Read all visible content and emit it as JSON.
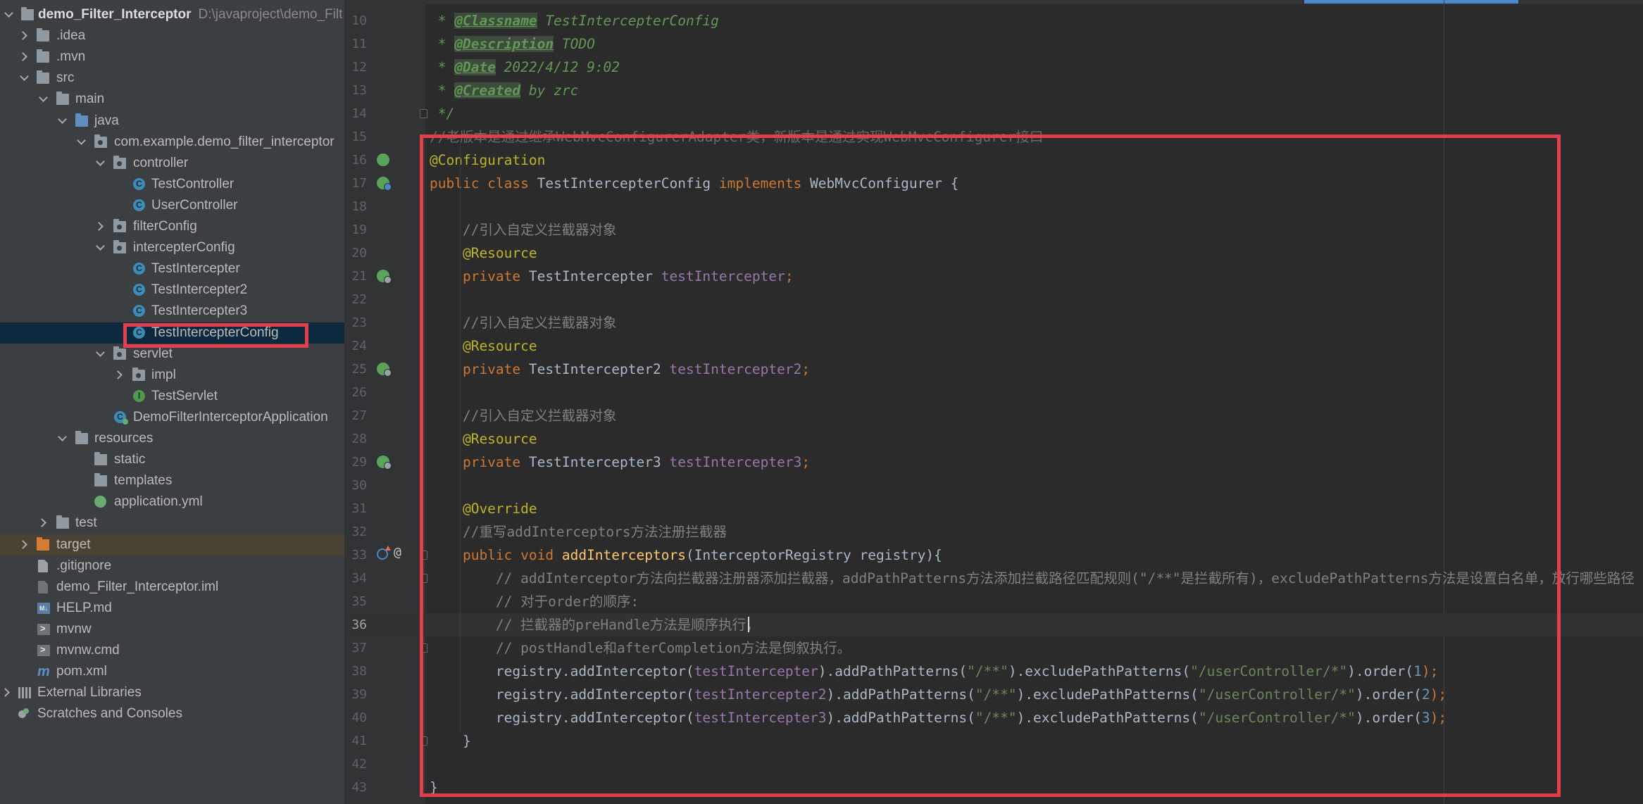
{
  "project_tree": {
    "root_name": "demo_Filter_Interceptor",
    "root_path": "D:\\javaproject\\demo_Filt",
    "items": [
      {
        "label": "demo_Filter_Interceptor"
      },
      {
        "label": ".idea"
      },
      {
        "label": ".mvn"
      },
      {
        "label": "src"
      },
      {
        "label": "main"
      },
      {
        "label": "java"
      },
      {
        "label": "com.example.demo_filter_interceptor"
      },
      {
        "label": "controller"
      },
      {
        "label": "TestController"
      },
      {
        "label": "UserController"
      },
      {
        "label": "filterConfig"
      },
      {
        "label": "intercepterConfig"
      },
      {
        "label": "TestIntercepter"
      },
      {
        "label": "TestIntercepter2"
      },
      {
        "label": "TestIntercepter3"
      },
      {
        "label": "TestIntercepterConfig"
      },
      {
        "label": "servlet"
      },
      {
        "label": "impl"
      },
      {
        "label": "TestServlet"
      },
      {
        "label": "DemoFilterInterceptorApplication"
      },
      {
        "label": "resources"
      },
      {
        "label": "static"
      },
      {
        "label": "templates"
      },
      {
        "label": "application.yml"
      },
      {
        "label": "test"
      },
      {
        "label": "target"
      },
      {
        "label": ".gitignore"
      },
      {
        "label": "demo_Filter_Interceptor.iml"
      },
      {
        "label": "HELP.md"
      },
      {
        "label": "mvnw"
      },
      {
        "label": "mvnw.cmd"
      },
      {
        "label": "pom.xml"
      },
      {
        "label": "External Libraries"
      },
      {
        "label": "Scratches and Consoles"
      }
    ]
  },
  "editor": {
    "file_name": "TestIntercepterConfig",
    "current_line": 36,
    "line_numbers": [
      "10",
      "11",
      "12",
      "13",
      "14",
      "15",
      "16",
      "17",
      "18",
      "19",
      "20",
      "21",
      "22",
      "23",
      "24",
      "25",
      "26",
      "27",
      "28",
      "29",
      "30",
      "31",
      "32",
      "33",
      "34",
      "35",
      "36",
      "37",
      "38",
      "39",
      "40",
      "41",
      "42",
      "43"
    ],
    "code": {
      "l10_star": " * ",
      "l10_tag": "@Classname",
      "l10_text": " TestIntercepterConfig",
      "l11_star": " * ",
      "l11_tag": "@Description",
      "l11_text": " TODO",
      "l12_star": " * ",
      "l12_tag": "@Date",
      "l12_text": " 2022/4/12 9:02",
      "l13_star": " * ",
      "l13_tag": "@Created",
      "l13_text": " by zrc",
      "l14": " */",
      "l15": "//老版本是通过继承WebMvcConfigurerAdapter类，新版本是通过实现WebMvcConfigurer接口",
      "l16": "@Configuration",
      "l17_kw1": "public class ",
      "l17_name": "TestIntercepterConfig ",
      "l17_kw2": "implements ",
      "l17_rest": "WebMvcConfigurer {",
      "l19": "    //引入自定义拦截器对象",
      "l20": "    @Resource",
      "l21_kw": "    private ",
      "l21_type": "TestIntercepter ",
      "l21_field": "testIntercepter",
      "l21_end": ";",
      "l23": "    //引入自定义拦截器对象",
      "l24": "    @Resource",
      "l25_kw": "    private ",
      "l25_type": "TestIntercepter2 ",
      "l25_field": "testIntercepter2",
      "l25_end": ";",
      "l27": "    //引入自定义拦截器对象",
      "l28": "    @Resource",
      "l29_kw": "    private ",
      "l29_type": "TestIntercepter3 ",
      "l29_field": "testIntercepter3",
      "l29_end": ";",
      "l31": "    @Override",
      "l32": "    //重写addInterceptors方法注册拦截器",
      "l33_kw": "    public void ",
      "l33_fn": "addInterceptors",
      "l33_rest": "(InterceptorRegistry registry){",
      "l34": "        // addInterceptor方法向拦截器注册器添加拦截器，addPathPatterns方法添加拦截路径匹配规则(\"/**\"是拦截所有)，excludePathPatterns方法是设置白名单，放行哪些路径",
      "l35": "        // 对于order的顺序:",
      "l36": "        // 拦截器的preHandle方法是顺序执行，",
      "l37": "        // postHandle和afterCompletion方法是倒叙执行。",
      "l38_a": "        registry.addInterceptor(",
      "l38_f": "testIntercepter",
      "l38_b": ").addPathPatterns(",
      "l38_s1": "\"/**\"",
      "l38_c": ").excludePathPatterns(",
      "l38_s2": "\"/userController/*\"",
      "l38_d": ").order(",
      "l38_n": "1",
      "l38_e": ");",
      "l39_a": "        registry.addInterceptor(",
      "l39_f": "testIntercepter2",
      "l39_b": ").addPathPatterns(",
      "l39_s1": "\"/**\"",
      "l39_c": ").excludePathPatterns(",
      "l39_s2": "\"/userController/*\"",
      "l39_d": ").order(",
      "l39_n": "2",
      "l39_e": ");",
      "l40_a": "        registry.addInterceptor(",
      "l40_f": "testIntercepter3",
      "l40_b": ").addPathPatterns(",
      "l40_s1": "\"/**\"",
      "l40_c": ").excludePathPatterns(",
      "l40_s2": "\"/userController/*\"",
      "l40_d": ").order(",
      "l40_n": "3",
      "l40_e": ");",
      "l41": "    }",
      "l43": "}"
    },
    "gutter_at": "@"
  },
  "colors": {
    "highlight_box": "#e43d4b",
    "keyword": "#cc7832",
    "annotation": "#bbb529",
    "field": "#9876aa",
    "string": "#6a8759"
  }
}
